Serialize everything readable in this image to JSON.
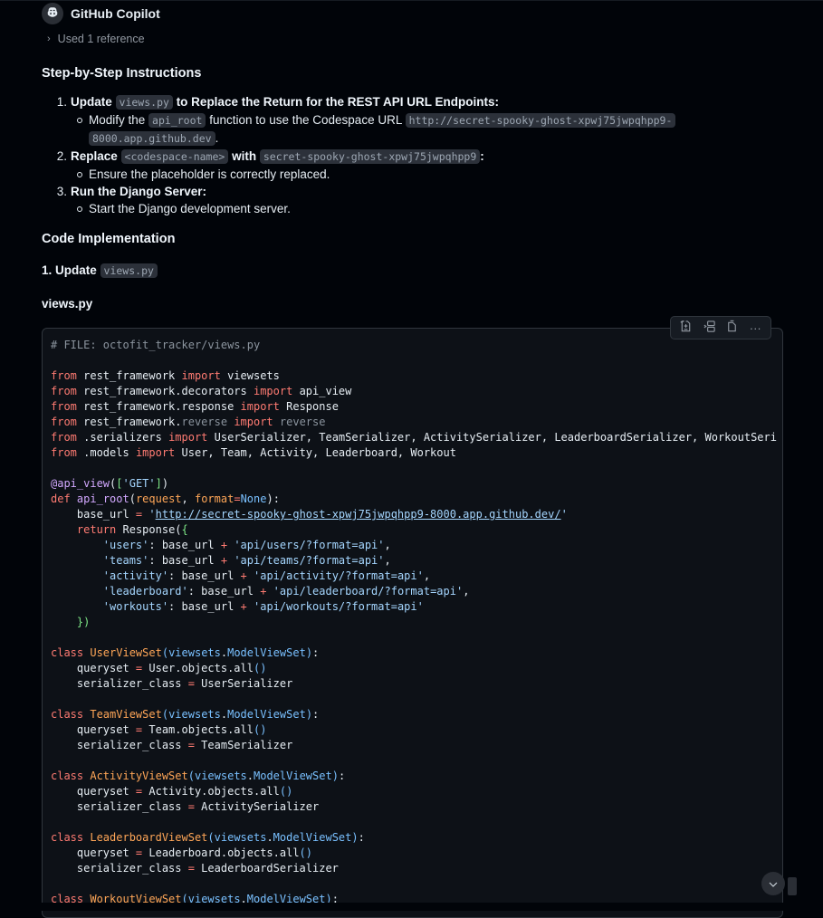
{
  "header": {
    "title": "GitHub Copilot",
    "icon": "copilot-icon"
  },
  "references": {
    "label": "Used 1 reference"
  },
  "sections": {
    "instructions_title": "Step-by-Step Instructions",
    "code_title": "Code Implementation",
    "update_prefix": "1. Update",
    "update_code": "views.py",
    "file_label": "views.py"
  },
  "steps": [
    {
      "num": "1.",
      "bold_a": "Update",
      "code_a": "views.py",
      "bold_b": "to Replace the Return for the REST API URL Endpoints:",
      "sub": {
        "text_a": "Modify the",
        "code_a": "api_root",
        "text_b": "function to use the Codespace URL",
        "code_b1": "http://secret-spooky-ghost-xpwj75jwpqhpp9-",
        "code_b2": "8000.app.github.dev",
        "text_c": "."
      }
    },
    {
      "num": "2.",
      "bold_a": "Replace",
      "code_a": "<codespace-name>",
      "bold_b": "with",
      "code_b": "secret-spooky-ghost-xpwj75jwpqhpp9",
      "tail": ":",
      "sub": {
        "text": "Ensure the placeholder is correctly replaced."
      }
    },
    {
      "num": "3.",
      "bold_a": "Run the Django Server:",
      "sub": {
        "text": "Start the Django development server."
      }
    }
  ],
  "code_toolbar": {
    "buttons": [
      {
        "name": "apply-in-editor",
        "icon": "apply-icon"
      },
      {
        "name": "insert-at-cursor",
        "icon": "insert-icon"
      },
      {
        "name": "copy",
        "icon": "copy-icon"
      },
      {
        "name": "more",
        "icon": "more-icon",
        "glyph": "···"
      }
    ]
  },
  "code": {
    "language": "python",
    "lines": [
      "# FILE: octofit_tracker/views.py",
      "",
      "from rest_framework import viewsets",
      "from rest_framework.decorators import api_view",
      "from rest_framework.response import Response",
      "from rest_framework.reverse import reverse",
      "from .serializers import UserSerializer, TeamSerializer, ActivitySerializer, LeaderboardSerializer, WorkoutSeri",
      "from .models import User, Team, Activity, Leaderboard, Workout",
      "",
      "@api_view(['GET'])",
      "def api_root(request, format=None):",
      "    base_url = 'http://secret-spooky-ghost-xpwj75jwpqhpp9-8000.app.github.dev/'",
      "    return Response({",
      "        'users': base_url + 'api/users/?format=api',",
      "        'teams': base_url + 'api/teams/?format=api',",
      "        'activity': base_url + 'api/activity/?format=api',",
      "        'leaderboard': base_url + 'api/leaderboard/?format=api',",
      "        'workouts': base_url + 'api/workouts/?format=api'",
      "    })",
      "",
      "class UserViewSet(viewsets.ModelViewSet):",
      "    queryset = User.objects.all()",
      "    serializer_class = UserSerializer",
      "",
      "class TeamViewSet(viewsets.ModelViewSet):",
      "    queryset = Team.objects.all()",
      "    serializer_class = TeamSerializer",
      "",
      "class ActivityViewSet(viewsets.ModelViewSet):",
      "    queryset = Activity.objects.all()",
      "    serializer_class = ActivitySerializer",
      "",
      "class LeaderboardViewSet(viewsets.ModelViewSet):",
      "    queryset = Leaderboard.objects.all()",
      "    serializer_class = LeaderboardSerializer",
      "",
      "class WorkoutViewSet(viewsets.ModelViewSet):"
    ]
  },
  "scroll_down": {
    "icon": "chevron-down-icon"
  },
  "colors": {
    "background": "#010409",
    "code_background": "#0d1117",
    "keyword": "#ff7b72",
    "class_name": "#ffa657",
    "builtin": "#79c0ff",
    "string": "#a5d6ff",
    "function": "#d2a8ff",
    "comment": "#8b949e"
  }
}
